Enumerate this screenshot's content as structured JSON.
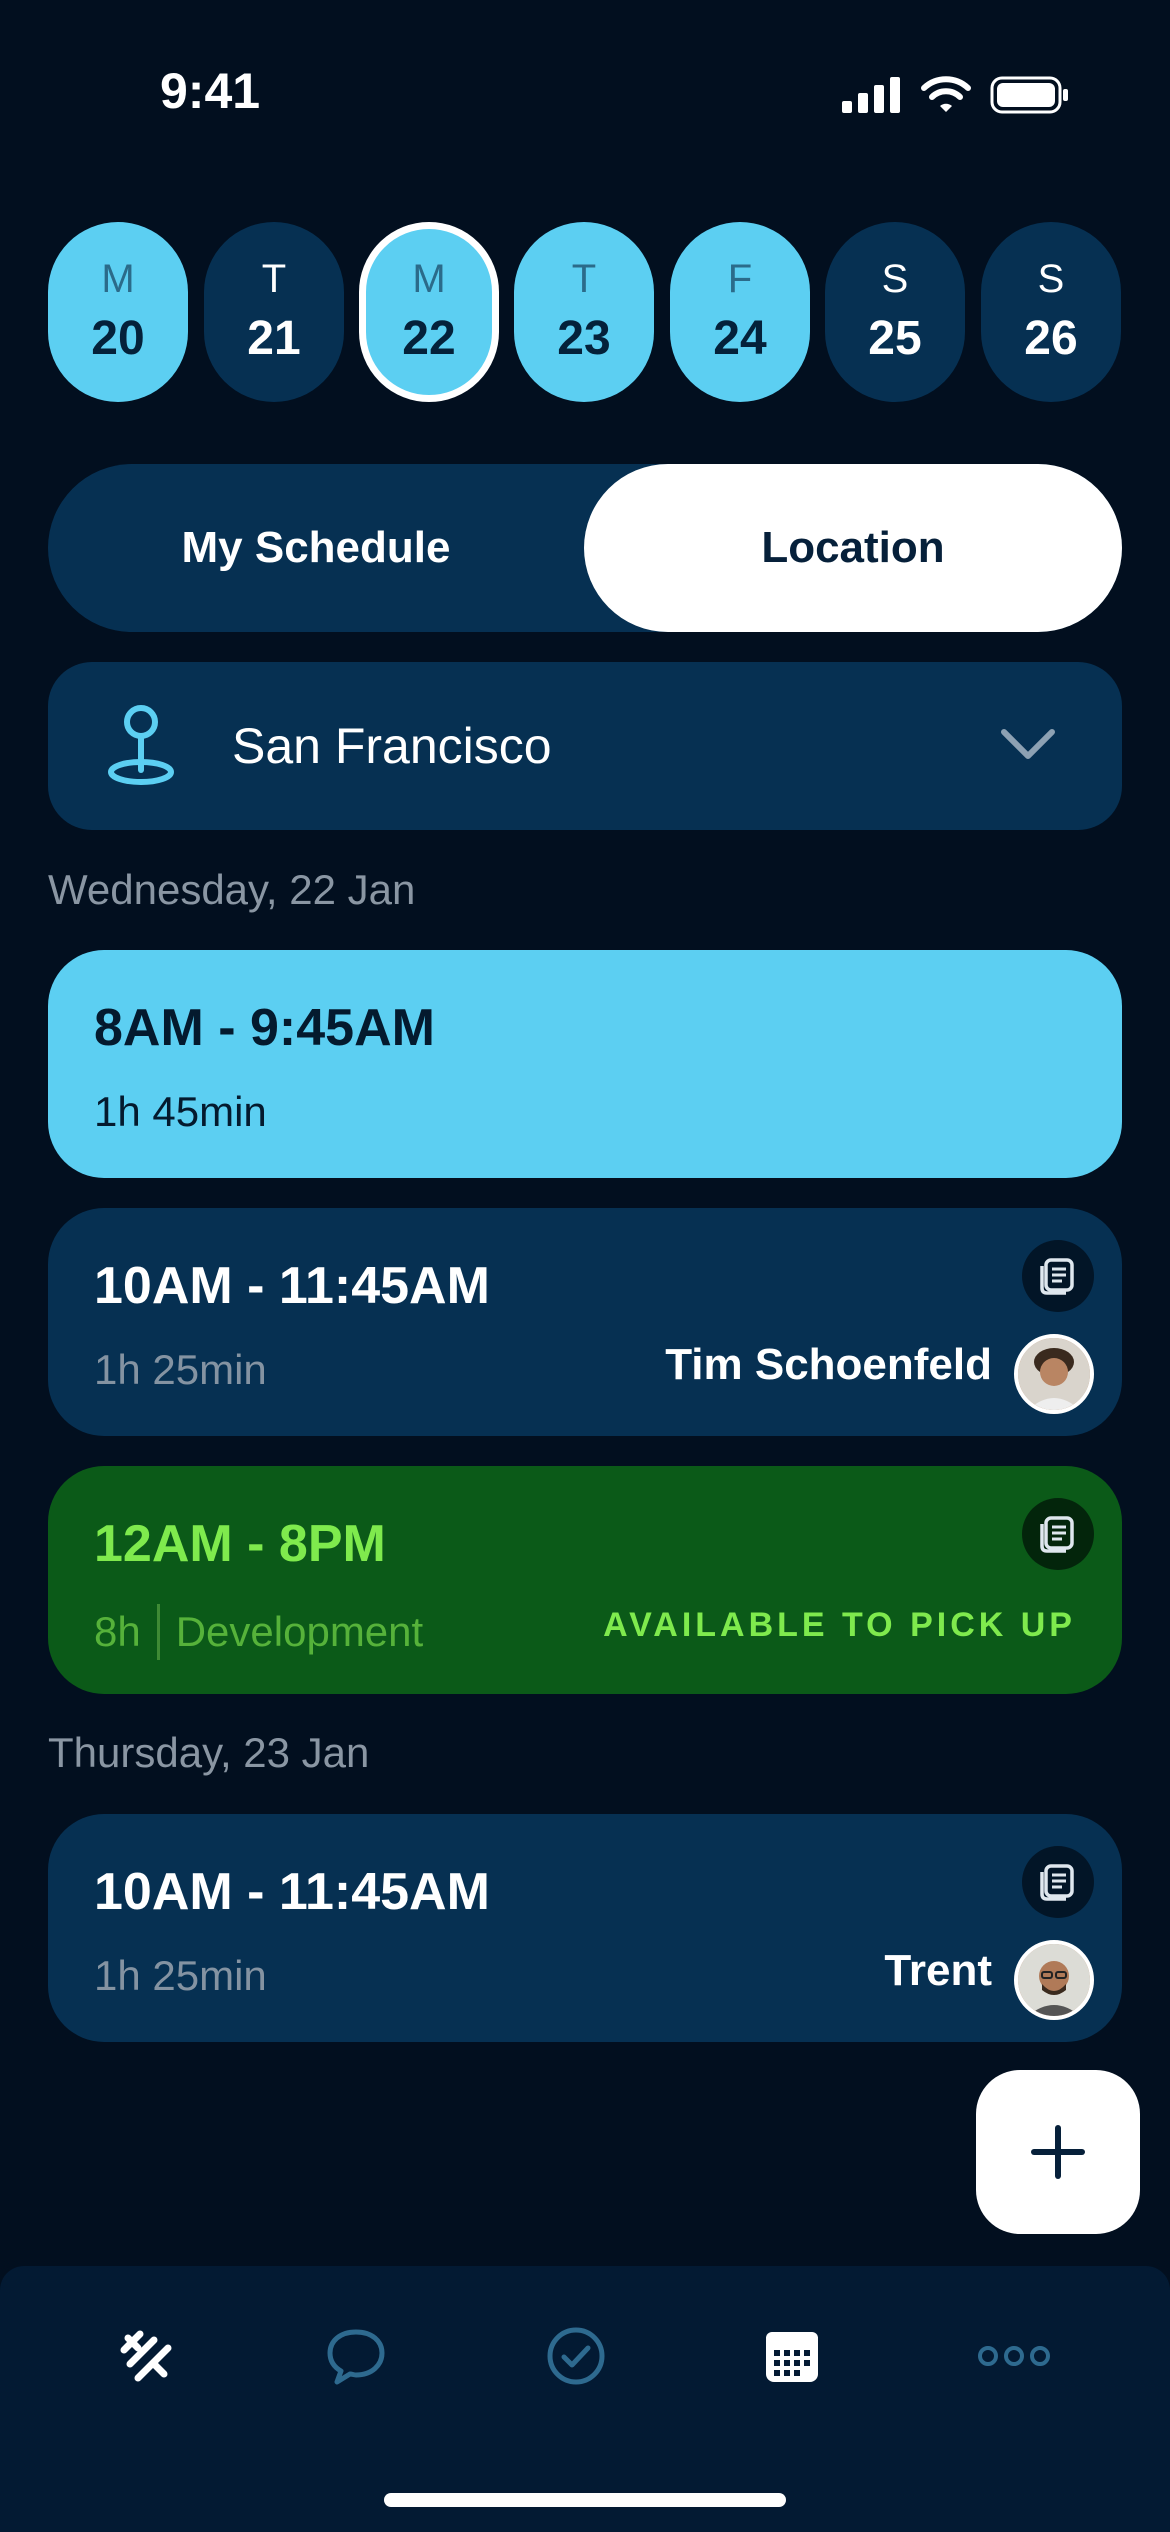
{
  "status_bar": {
    "time": "9:41"
  },
  "days": [
    {
      "letter": "M",
      "number": "20",
      "style": "light"
    },
    {
      "letter": "T",
      "number": "21",
      "style": "dark"
    },
    {
      "letter": "M",
      "number": "22",
      "style": "selected"
    },
    {
      "letter": "T",
      "number": "23",
      "style": "light"
    },
    {
      "letter": "F",
      "number": "24",
      "style": "light"
    },
    {
      "letter": "S",
      "number": "25",
      "style": "dark"
    },
    {
      "letter": "S",
      "number": "26",
      "style": "dark"
    }
  ],
  "segmented": {
    "left": "My Schedule",
    "right": "Location",
    "active": "Location"
  },
  "location": {
    "value": "San Francisco"
  },
  "sections": [
    {
      "date": "Wednesday, 22 Jan",
      "shifts": [
        {
          "time": "8AM - 9:45AM",
          "duration": "1h 45min"
        },
        {
          "time": "10AM - 11:45AM",
          "duration": "1h 25min",
          "name": "Tim Schoenfeld"
        },
        {
          "time": "12AM - 8PM",
          "duration": "8h",
          "department": "Development",
          "tag": "AVAILABLE TO PICK UP"
        }
      ]
    },
    {
      "date": "Thursday, 23 Jan",
      "shifts": [
        {
          "time": "10AM - 11:45AM",
          "duration": "1h 25min",
          "name": "Trent"
        }
      ]
    }
  ],
  "colors": {
    "background": "#020f1f",
    "accent": "#5ccff2",
    "card": "#063052",
    "available": "#0b5a18",
    "available_text": "#7fea4d"
  },
  "tabs": [
    "home-icon",
    "chat-icon",
    "check-icon",
    "calendar-icon",
    "more-icon"
  ],
  "active_tab": "calendar-icon"
}
